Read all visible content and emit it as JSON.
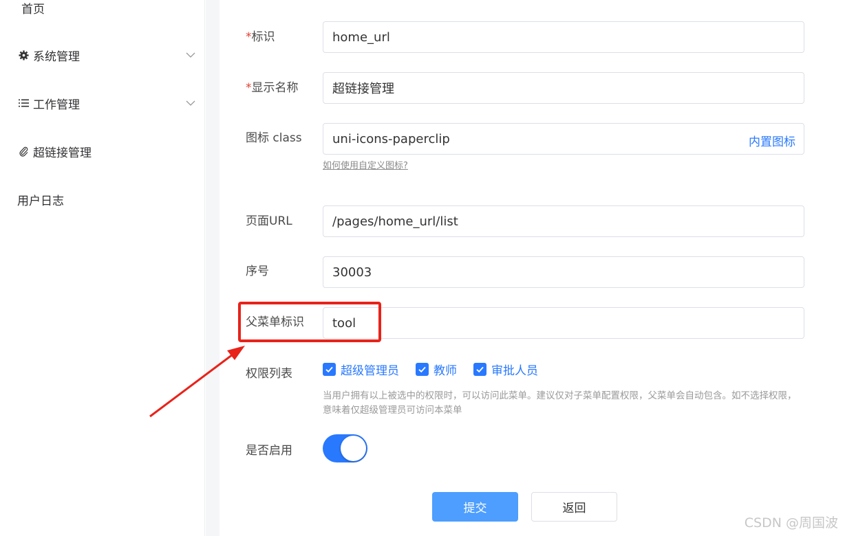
{
  "sidebar": {
    "items": [
      {
        "label": "首页",
        "icon": ""
      },
      {
        "label": "系统管理",
        "icon": "gear-icon"
      },
      {
        "label": "工作管理",
        "icon": "list-icon"
      },
      {
        "label": "超链接管理",
        "icon": "paperclip-icon"
      },
      {
        "label": "用户日志",
        "icon": ""
      }
    ]
  },
  "form": {
    "id_label": "标识",
    "id_required": "*",
    "id_value": "home_url",
    "name_label": "显示名称",
    "name_required": "*",
    "name_value": "超链接管理",
    "icon_label": "图标 class",
    "icon_value": "uni-icons-paperclip",
    "icon_builtin": "内置图标",
    "icon_help": "如何使用自定义图标?",
    "url_label": "页面URL",
    "url_value": "/pages/home_url/list",
    "sort_label": "序号",
    "sort_value": "30003",
    "parent_label": "父菜单标识",
    "parent_value": "tool",
    "perm_label": "权限列表",
    "permissions": [
      {
        "label": "超级管理员",
        "checked": true
      },
      {
        "label": "教师",
        "checked": true
      },
      {
        "label": "审批人员",
        "checked": true
      }
    ],
    "perm_hint": "当用户拥有以上被选中的权限时，可以访问此菜单。建议仅对子菜单配置权限，父菜单会自动包含。如不选择权限，意味着仅超级管理员可访问本菜单",
    "enable_label": "是否启用",
    "enabled": true,
    "submit": "提交",
    "back": "返回"
  },
  "watermark": "CSDN @周国波",
  "colors": {
    "primary": "#2979ff",
    "highlight": "#e8231a",
    "required": "#e43d33"
  }
}
